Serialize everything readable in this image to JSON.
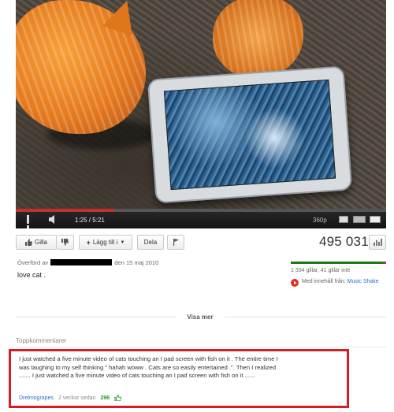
{
  "player": {
    "current_time": "1:25",
    "duration": "5:21",
    "time_display": "1:25 / 5:21",
    "quality": "360p",
    "progress": 0.265
  },
  "actions": {
    "like_label": "Gilla",
    "add_label": "Lägg till i",
    "share_label": "Dela"
  },
  "views": "495 031",
  "upload": {
    "prefix": "Överförd av",
    "suffix": "den 15 maj 2010"
  },
  "description": "love cat .",
  "rating": {
    "text": "1 334 gillar, 41 gillar inte",
    "like_ratio": 0.97
  },
  "music": {
    "label": "Med innehåll från:",
    "link": "Music Shake"
  },
  "show_more": "Visa mer",
  "comments": {
    "heading": "Toppkommentarer",
    "top": {
      "text": "I just watched a five minute video of cats touching an I pad screen with fish on it . The entire time I was laughing to my self thinking \" hahah woww . Cats are so easily entertained .\". Then I realized ....... I just watched a five minute video of cats touching an I pad screen with fish on it ......",
      "author": "Drelmograpes",
      "time": "2 veckor sedan",
      "likes": "296"
    }
  },
  "colors": {
    "progress": "#c4302b",
    "link": "#2a6fc9",
    "highlight": "#d21f27",
    "like_bar": "#1a7a1a"
  }
}
